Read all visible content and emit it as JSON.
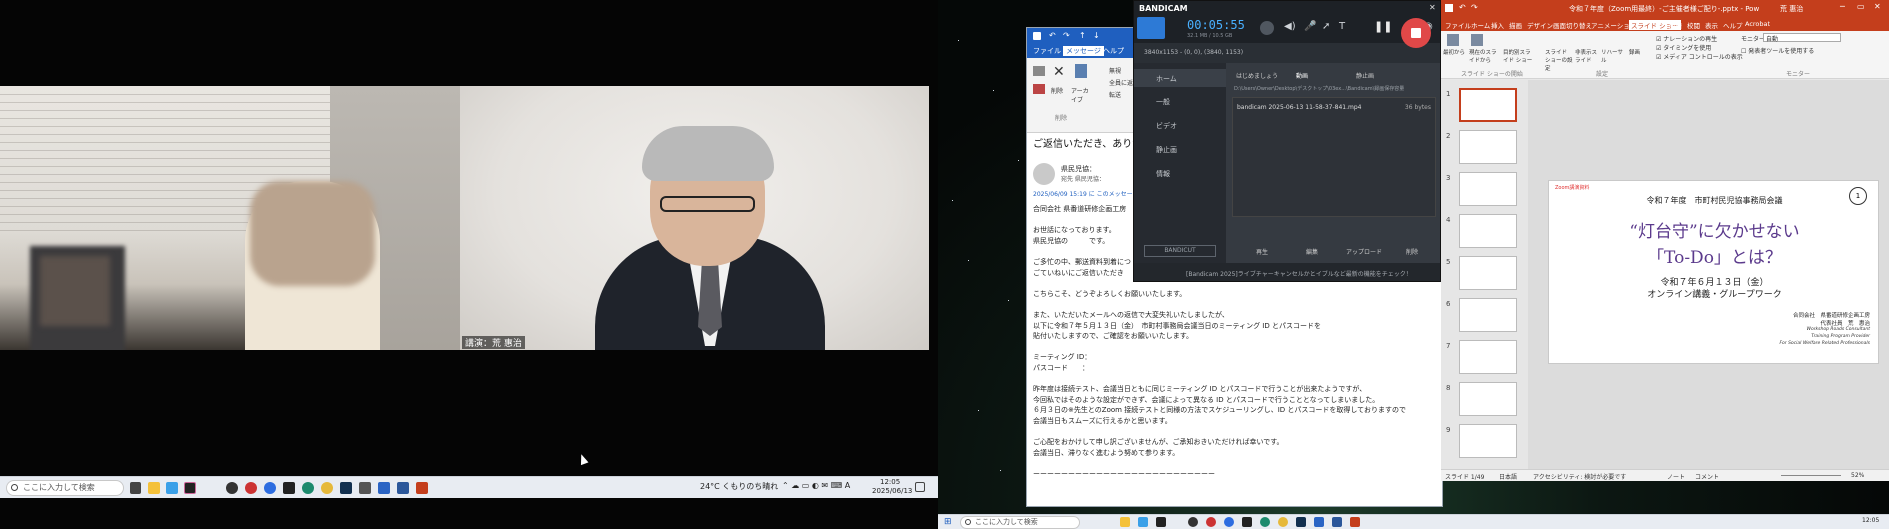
{
  "left_monitor": {
    "zoom": {
      "speaker_label": "講演：荒 惠治"
    },
    "taskbar": {
      "search_placeholder": "ここに入力して検索",
      "weather": "24°C  くもりのち晴れ",
      "clock_time": "12:05",
      "clock_date": "2025/06/13"
    }
  },
  "outlook": {
    "tabs": [
      "ファイル",
      "メッセージ",
      "ヘルプ"
    ],
    "ribbon": {
      "delete": "削除",
      "archive": "アーカイブ",
      "ignore": "無視",
      "reply_all": "全員に返信",
      "forward": "転送",
      "group_delete": "削除"
    },
    "subject": "ご返信いただき、ありがとう",
    "sender": "県民児協：",
    "recipient": "宛先  県民児協：",
    "date_note": "2025/06/09 15:19 に このメッセージ",
    "body": [
      "合同会社 県番道研修企画工房",
      "",
      "お世話になっております。",
      "県民児協の　　　です。",
      "",
      "ご多忙の中、郵送資料到着につ",
      "ごていねいにご返信いただき",
      "",
      "こちらこそ、どうぞよろしくお願いいたします。",
      "",
      "また、いただいたメールへの返信で大変失礼いたしましたが、",
      "以下に令和７年５月１３日（金）　市町村事務局会議当日のミーティング ID とパスコードを",
      "貼付いたしますので、ご確認をお願いいたします。",
      "",
      "ミーティング ID：",
      "パスコード　　：",
      "",
      "昨年度は接続テスト、会議当日ともに同じミーティング ID とパスコードで行うことが出来たようですが、",
      "今回私ではそのような設定ができず、会議によって異なる ID とパスコードで行うこととなってしまいました。",
      "６月３日の※先生とのZoom 接続テストと同様の方法でスケジューリングし、ID とパスコードを取得しておりますので",
      "会議当日もスムーズに行えるかと思います。",
      "",
      "ご心配をおかけして申し訳ございませんが、ご承知おきいただければ幸いです。",
      "会議当日、滞りなく進むよう努めて参ります。",
      "",
      "ーーーーーーーーーーーーーーーーーーーーーーーーーー"
    ]
  },
  "bandicam": {
    "brand": "BANDICAM",
    "timer": "00:05:55",
    "size_info": "32.1 MB / 10.5 GB",
    "resolution_bar": "3840x1153 - (0, 0), (3840, 1153)",
    "nav": [
      "ホーム",
      "一般",
      "ビデオ",
      "静止画",
      "情報"
    ],
    "tabs": [
      "はじめましょう",
      "動画",
      "静止画"
    ],
    "path": "D:\\Users\\Owner\\Desktop\\デスクトップ\\03ex...\\Bandicam\\録画保存容量",
    "file_name": "bandicam 2025-06-13 11-58-37-841.mp4",
    "file_size": "36 bytes",
    "buttons": [
      "再生",
      "編集",
      "アップロード",
      "削除"
    ],
    "footer": "[Bandicam 2025]ライブチャーキャンセルかとイブルなど最新の機能をチェック！",
    "bandicut": "BANDICUT"
  },
  "powerpoint": {
    "title": "令和７年度（Zoom用最終）-ご主催者様ご配り-.pptx - PowerPoint",
    "user": "荒 惠治",
    "tabs": [
      "ファイル",
      "ホーム",
      "挿入",
      "描画",
      "デザイン",
      "画面切り替え",
      "アニメーション",
      "スライド ショー",
      "記録",
      "校閲",
      "表示",
      "ヘルプ",
      "Acrobat"
    ],
    "ribbon": {
      "from_start": "最初から",
      "from_current": "現在のスライドから",
      "custom": "目的別スライド ショー",
      "setup": "スライド ショーの設定",
      "hide": "非表示スライド",
      "rehearse": "リハーサル",
      "record": "録画",
      "group_start": "スライド ショーの開始",
      "group_setup": "設定",
      "chk_narration": "ナレーションの再生",
      "chk_timing": "タイミングを使用",
      "chk_media": "メディア コントロールの表示",
      "monitor_label": "モニター:",
      "monitor_value": "自動",
      "presenter_view": "発表者ツールを使用する",
      "group_monitor": "モニター"
    },
    "thumb_numbers": [
      "1",
      "2",
      "3",
      "4",
      "5",
      "6",
      "7",
      "8",
      "9"
    ],
    "slide": {
      "tag": "Zoom講演資料",
      "header": "令和７年度　市町村民児協事務局会議",
      "title_line1": "“灯台守”に欠かせない",
      "title_line2": "「To-Do」とは？",
      "date": "令和７年６月１３日（金）",
      "subtitle": "オンライン講義・グループワーク",
      "org": "合同会社　県番道研修企画工房",
      "rep": "代表社員　荒　惠治",
      "en1": "Workshop Roads Consultant",
      "en2": "Training Program Provider",
      "en3": "For Social Welfare Related Professionals",
      "page_num": "1"
    },
    "status": {
      "slide_count": "スライド 1/49",
      "lang": "日本語",
      "accessibility": "アクセシビリティ: 検討が必要です",
      "notes": "ノート",
      "comments": "コメント",
      "zoom": "52%"
    }
  },
  "right_taskbar": {
    "search_placeholder": "ここに入力して検索",
    "clock_time": "12:05"
  }
}
